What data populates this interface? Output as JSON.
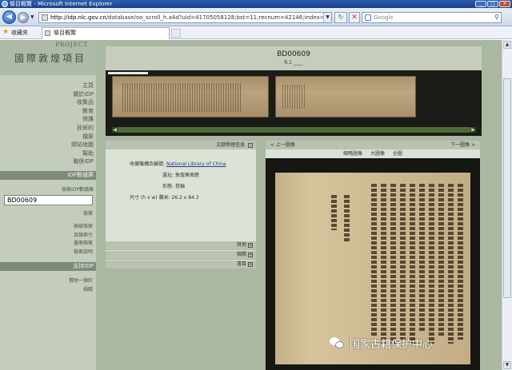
{
  "window": {
    "title": "條目概覽 - Microsoft Internet Explorer"
  },
  "toolbar": {
    "address_host": "http://idp.nlc.gov.cn",
    "address_path": "/database/oo_scroll_h.a4d?uid=41705058128;bst=11;recnum=42146;index=11",
    "search_placeholder": "Google"
  },
  "favbar": {
    "favorites_label": "收藏夾",
    "tab_title": "條目概覽"
  },
  "sidebar": {
    "logo_project": "PROJECT",
    "logo_title": "國際敦煌項目",
    "nav": [
      "主頁",
      "關於IDP",
      "收集品",
      "教育",
      "保護",
      "技術的",
      "檔案",
      "網站地圖",
      "幫助",
      "聯係IDP"
    ],
    "db_header": "IDP數據庫",
    "search_label": "檢索IDP數據庫",
    "search_value": "BD00609",
    "search_submit": "檢索",
    "nav2": [
      "高級檢索",
      "目錄索引",
      "畫冊檢索",
      "檢索說明"
    ],
    "support_header": "支持IDP",
    "nav3": [
      "贊助一個紅",
      "捐贈"
    ]
  },
  "viewer": {
    "record_id": "BD00609",
    "record_sub": "R.1 ____"
  },
  "info": {
    "header": "文獻物理信息",
    "institution_label": "收藏機構及編號:",
    "institution_value": "National Library of China",
    "site_label": "遺址:",
    "site_value": "敦煌莫高窟",
    "form_label": "形態:",
    "form_value": "卷軸",
    "size_label": "尺寸 (h x w) 釐米:",
    "size_value": "26.2 x 84.3",
    "collapsed": [
      "其他",
      "相關",
      "書目"
    ]
  },
  "image_panel": {
    "prev": "< 上一圖像",
    "next": "下一圖像 >",
    "tools": [
      "縮略圖像",
      "大圖像",
      "全圖"
    ]
  },
  "watermark": "国家古籍保护中心"
}
